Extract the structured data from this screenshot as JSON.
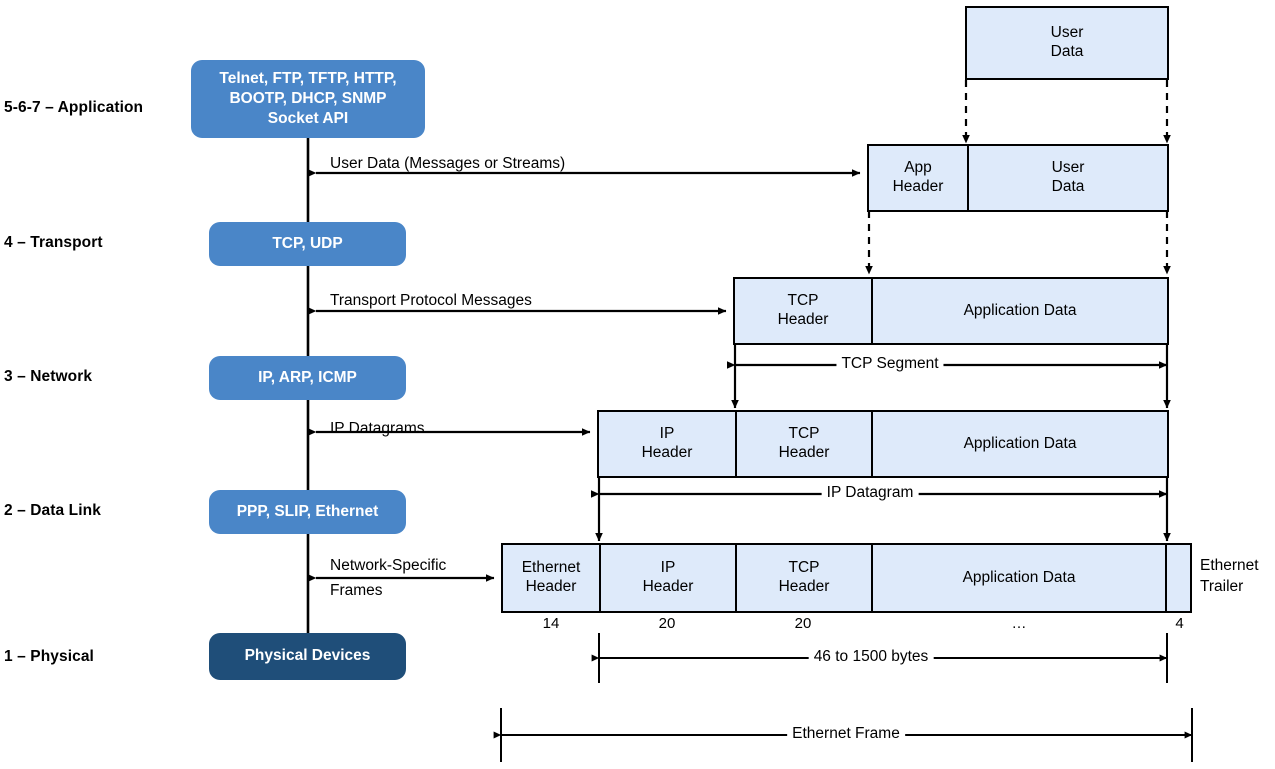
{
  "diagram": {
    "title": "TCP/IP Protocol Stack Encapsulation",
    "colors": {
      "layer_blue": "#4a86c8",
      "physical_blue": "#1f4e79",
      "packet_fill": "#deeafa",
      "stroke": "#000000",
      "background": "#ffffff"
    }
  },
  "layers": [
    {
      "name": "5-6-7 – Application",
      "protocols": "Telnet, FTP, TFTP, HTTP,\nBOOTP, DHCP, SNMP\nSocket API",
      "protocols_lines": [
        "Telnet, FTP, TFTP, HTTP,",
        "BOOTP, DHCP, SNMP",
        "Socket API"
      ]
    },
    {
      "name": "4 – Transport",
      "protocols": "TCP, UDP",
      "protocols_lines": [
        "TCP, UDP"
      ]
    },
    {
      "name": "3 – Network",
      "protocols": "IP, ARP, ICMP",
      "protocols_lines": [
        "IP, ARP, ICMP"
      ]
    },
    {
      "name": "2 – Data Link",
      "protocols": "PPP, SLIP, Ethernet",
      "protocols_lines": [
        "PPP, SLIP, Ethernet"
      ]
    },
    {
      "name": "1 – Physical",
      "protocols": "Physical Devices",
      "protocols_lines": [
        "Physical Devices"
      ]
    }
  ],
  "interface_labels": [
    {
      "line1": "User Data (Messages or Streams)",
      "line2": ""
    },
    {
      "line1": "Transport Protocol Messages",
      "line2": ""
    },
    {
      "line1": "IP Datagrams",
      "line2": ""
    },
    {
      "line1": "Network-Specific",
      "line2": "Frames"
    }
  ],
  "pdu_rows": [
    {
      "id": "user-data",
      "cells": [
        {
          "label": "User\nData",
          "lines": [
            "User",
            "Data"
          ]
        }
      ]
    },
    {
      "id": "app-message",
      "cells": [
        {
          "label": "App\nHeader",
          "lines": [
            "App",
            "Header"
          ]
        },
        {
          "label": "User\nData",
          "lines": [
            "User",
            "Data"
          ]
        }
      ]
    },
    {
      "id": "tcp-segment",
      "cells": [
        {
          "label": "TCP\nHeader",
          "lines": [
            "TCP",
            "Header"
          ]
        },
        {
          "label": "Application Data",
          "lines": [
            "Application Data"
          ]
        }
      ]
    },
    {
      "id": "ip-datagram",
      "cells": [
        {
          "label": "IP\nHeader",
          "lines": [
            "IP",
            "Header"
          ]
        },
        {
          "label": "TCP\nHeader",
          "lines": [
            "TCP",
            "Header"
          ]
        },
        {
          "label": "Application Data",
          "lines": [
            "Application Data"
          ]
        }
      ]
    },
    {
      "id": "ethernet-frame",
      "cells": [
        {
          "label": "Ethernet\nHeader",
          "lines": [
            "Ethernet",
            "Header"
          ]
        },
        {
          "label": "IP\nHeader",
          "lines": [
            "IP",
            "Header"
          ]
        },
        {
          "label": "TCP\nHeader",
          "lines": [
            "TCP",
            "Header"
          ]
        },
        {
          "label": "Application Data",
          "lines": [
            "Application Data"
          ]
        },
        {
          "label": "",
          "lines": [
            ""
          ]
        }
      ],
      "outside_label": {
        "lines": [
          "Ethernet",
          "Trailer"
        ]
      },
      "byte_counts": [
        "14",
        "20",
        "20",
        "…",
        "4"
      ]
    }
  ],
  "span_labels": [
    {
      "text": "TCP Segment"
    },
    {
      "text": "IP Datagram"
    },
    {
      "text": "46 to 1500 bytes"
    },
    {
      "text": "Ethernet Frame"
    }
  ]
}
